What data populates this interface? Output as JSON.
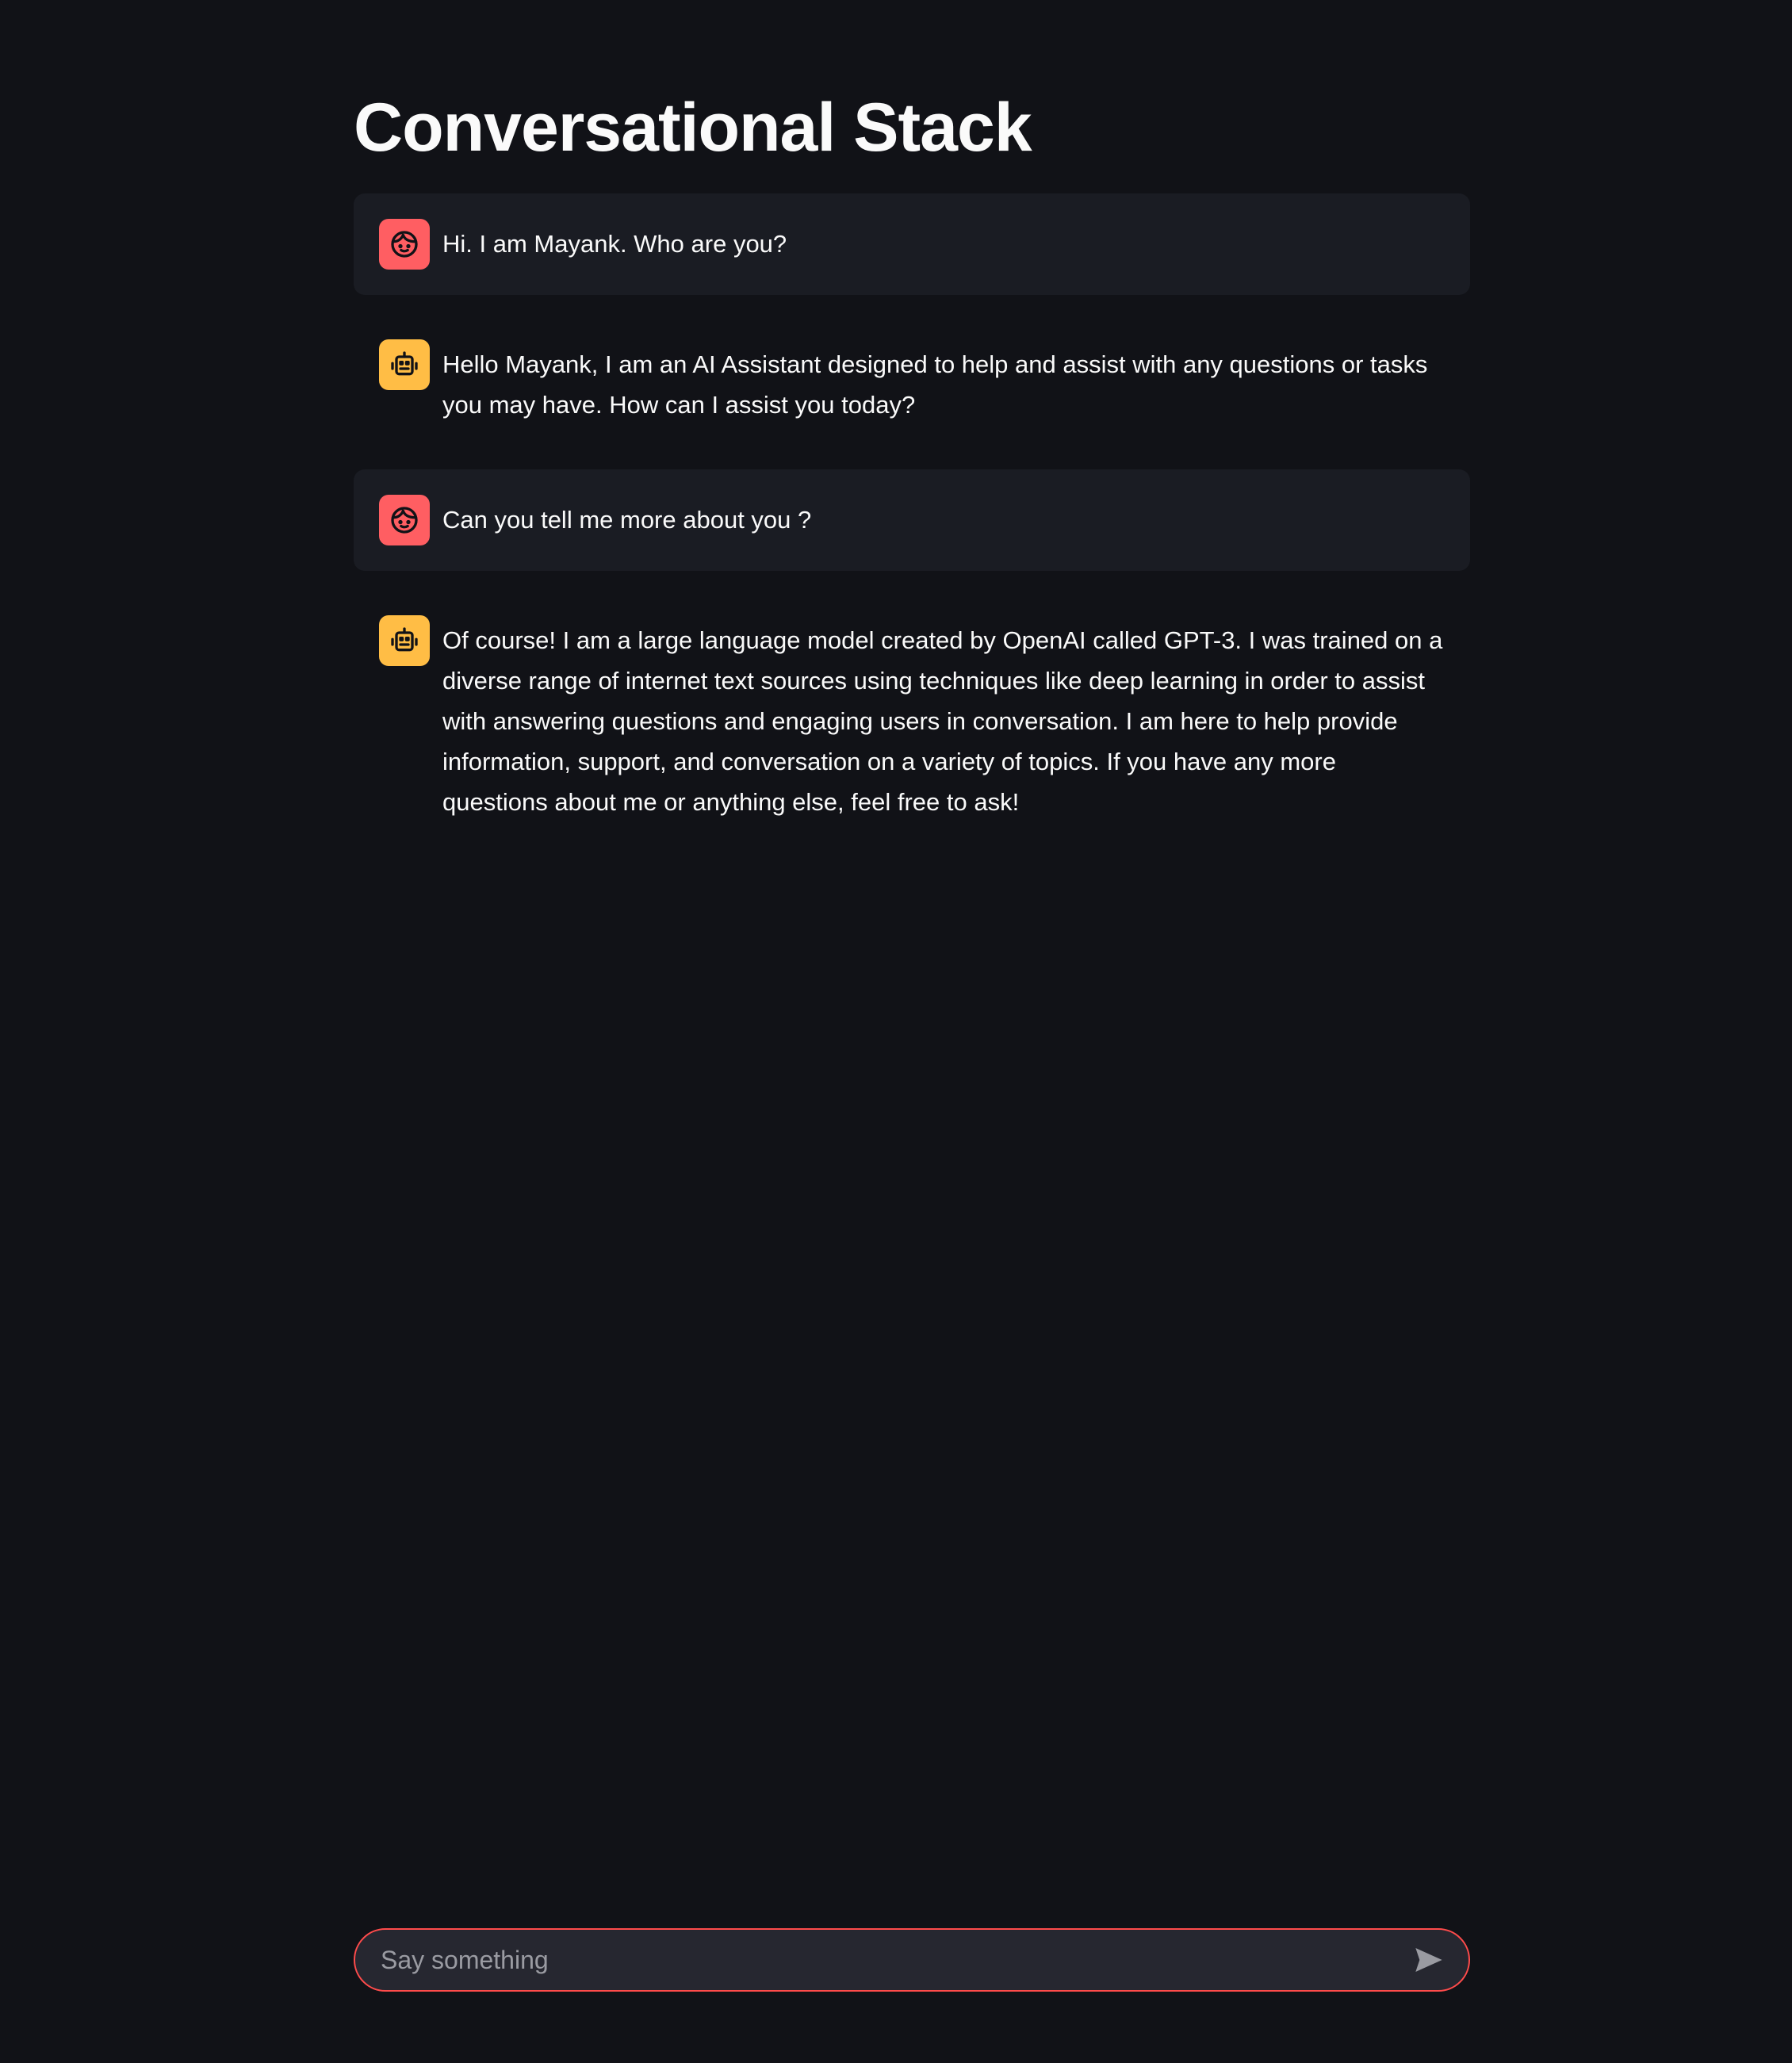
{
  "page": {
    "title": "Conversational Stack"
  },
  "messages": [
    {
      "role": "user",
      "avatar_icon": "user-face-icon",
      "avatar_color": "#ff5e62",
      "text": "Hi. I am Mayank. Who are you?"
    },
    {
      "role": "assistant",
      "avatar_icon": "robot-icon",
      "avatar_color": "#ffbd45",
      "text": "Hello Mayank, I am an AI Assistant designed to help and assist with any questions or tasks you may have. How can I assist you today?"
    },
    {
      "role": "user",
      "avatar_icon": "user-face-icon",
      "avatar_color": "#ff5e62",
      "text": "Can you tell me more about you ?"
    },
    {
      "role": "assistant",
      "avatar_icon": "robot-icon",
      "avatar_color": "#ffbd45",
      "text": "Of course! I am a large language model created by OpenAI called GPT-3. I was trained on a diverse range of internet text sources using techniques like deep learning in order to assist with answering questions and engaging users in conversation. I am here to help provide information, support, and conversation on a variety of topics. If you have any more questions about me or anything else, feel free to ask!"
    }
  ],
  "chat_input": {
    "placeholder": "Say something",
    "value": "",
    "border_color": "#ff4b4b",
    "send_icon": "send-icon"
  },
  "theme": {
    "background": "#111217",
    "user_bubble": "#1a1c23",
    "text": "#fafafa"
  }
}
